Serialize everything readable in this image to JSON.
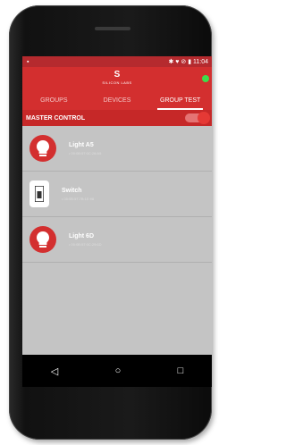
{
  "status": {
    "left": "▪",
    "right": "✱ ♥ ⊘ ▮ 11:04"
  },
  "app": {
    "logo_mark": "S",
    "logo_text": "SILICON LABS"
  },
  "tabs": [
    {
      "label": "GROUPS"
    },
    {
      "label": "DEVICES"
    },
    {
      "label": "GROUP TEST"
    }
  ],
  "master": {
    "label": "MASTER CONTROL"
  },
  "devices": [
    {
      "name": "Light A5",
      "sub": "•  00:0B:57:0C:26:A5",
      "icon": "bulb-icon"
    },
    {
      "name": "Switch",
      "sub": "•  00:0B:57:7B:1E:98",
      "icon": "switch-icon"
    },
    {
      "name": "Light 6D",
      "sub": "•  00:0B:57:0C:29:6D",
      "icon": "bulb-icon"
    }
  ],
  "nav": {
    "back": "◁",
    "home": "○",
    "recent": "□"
  },
  "colors": {
    "brand": "#d32f2f",
    "status": "#b52a2e",
    "accent": "#3ddc4b"
  }
}
